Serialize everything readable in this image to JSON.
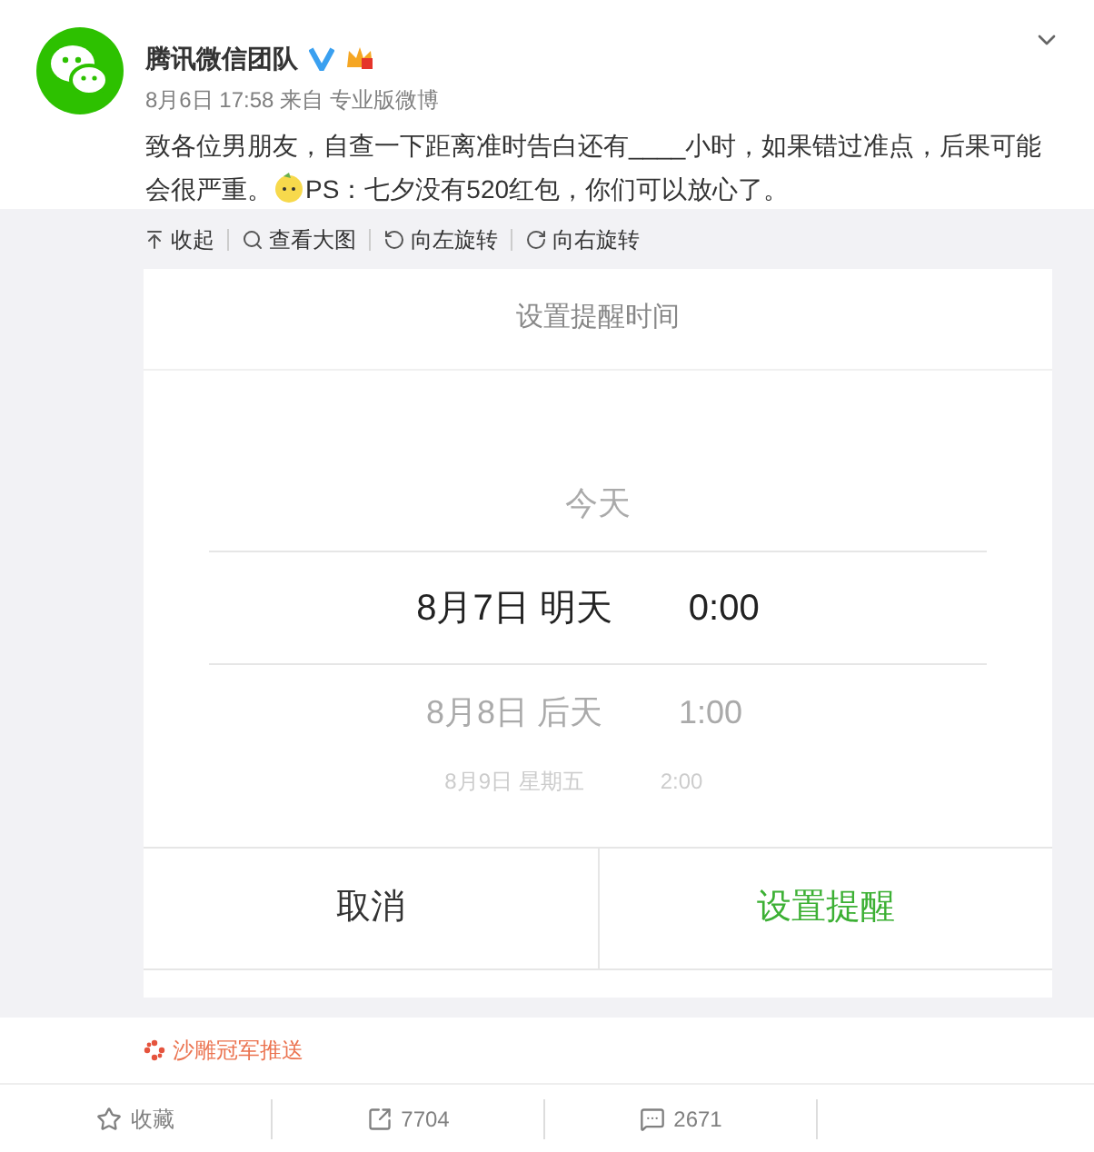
{
  "post": {
    "author": "腾讯微信团队",
    "meta": "8月6日 17:58 来自 专业版微博",
    "text": "致各位男朋友，自查一下距离准时告白还有____小时，如果错过准点，后果可能会很严重。",
    "text_after_emoji": "PS：七夕没有520红包，你们可以放心了。"
  },
  "image_toolbar": [
    {
      "kind": "collapse",
      "label": "收起"
    },
    {
      "kind": "zoom",
      "label": "查看大图"
    },
    {
      "kind": "rotate_left",
      "label": "向左旋转"
    },
    {
      "kind": "rotate_right",
      "label": "向右旋转"
    }
  ],
  "dialog": {
    "title": "设置提醒时间",
    "picker_rows": [
      {
        "date": "今天",
        "selected": false
      },
      {
        "date": "8月7日 明天",
        "time": "0:00",
        "selected": true
      },
      {
        "date": "8月8日 后天",
        "time": "1:00",
        "selected": false
      },
      {
        "date": "8月9日 星期五",
        "time": "2:00",
        "selected": false
      }
    ],
    "buttons": [
      {
        "kind": "cancel",
        "label": "取消"
      },
      {
        "kind": "confirm",
        "label": "设置提醒"
      }
    ]
  },
  "promo": "沙雕冠军推送",
  "actions": [
    {
      "kind": "favorite",
      "label": "收藏"
    },
    {
      "kind": "repost",
      "label": "7704"
    },
    {
      "kind": "comment",
      "label": "2671"
    }
  ]
}
